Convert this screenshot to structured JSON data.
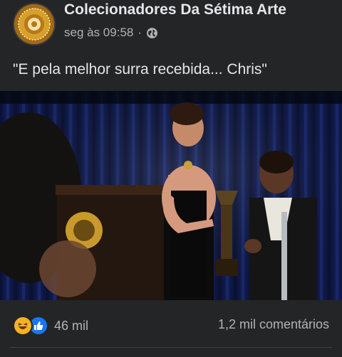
{
  "post": {
    "page_name": "Colecionadores Da Sétima Arte",
    "timestamp": "seg às 09:58",
    "separator": "·",
    "privacy_icon": "globe-icon",
    "caption": "\"E pela melhor surra recebida... Chris\""
  },
  "footer": {
    "reaction_icons": [
      "haha-icon",
      "like-icon"
    ],
    "reaction_count": "46 mil",
    "comments_label": "1,2 mil comentários"
  },
  "colors": {
    "background": "#242526",
    "primary_text": "#e4e6eb",
    "secondary_text": "#b0b3b8",
    "like_blue": "#1877f2",
    "haha_yellow": "#f7b125"
  }
}
